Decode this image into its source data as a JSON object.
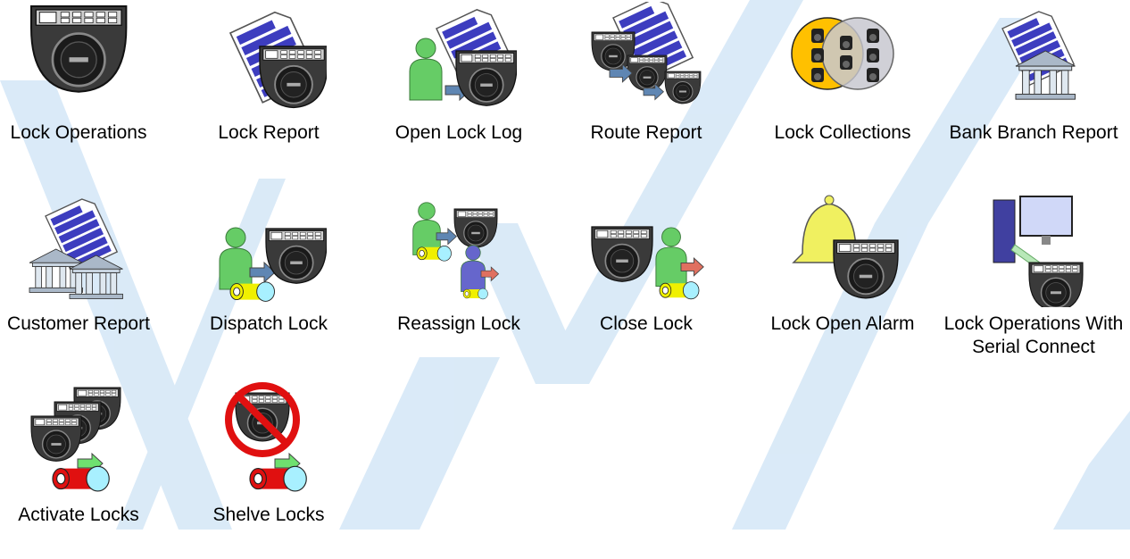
{
  "colors": {
    "watermark": "#cfe3f5",
    "lock_dark": "#3a3a3a",
    "lock_face": "#1a1a1a",
    "report_blue": "#3d3dbf",
    "person_green": "#66cc66",
    "person_purple": "#6666cc",
    "arrow_blue": "#5f86b3",
    "arrow_red": "#e07060",
    "arrow_green": "#6fe06f",
    "bell_yellow": "#f0f060",
    "collection_yellow": "#ffc000",
    "shelve_red": "#e01010"
  },
  "tiles": [
    {
      "label": "Lock Operations",
      "icon": "lock-keypad-icon"
    },
    {
      "label": "Lock Report",
      "icon": "lock-report-icon"
    },
    {
      "label": "Open Lock Log",
      "icon": "open-lock-log-icon"
    },
    {
      "label": "Route Report",
      "icon": "route-report-icon"
    },
    {
      "label": "Lock Collections",
      "icon": "lock-collections-icon"
    },
    {
      "label": "Bank Branch Report",
      "icon": "bank-branch-report-icon"
    },
    {
      "label": "Customer Report",
      "icon": "customer-report-icon"
    },
    {
      "label": "Dispatch Lock",
      "icon": "dispatch-lock-icon"
    },
    {
      "label": "Reassign Lock",
      "icon": "reassign-lock-icon"
    },
    {
      "label": "Close Lock",
      "icon": "close-lock-icon"
    },
    {
      "label": "Lock Open Alarm",
      "icon": "lock-open-alarm-icon"
    },
    {
      "label": "Lock Operations With\nSerial Connect",
      "icon": "serial-connect-icon"
    },
    {
      "label": "Activate Locks",
      "icon": "activate-locks-icon"
    },
    {
      "label": "Shelve Locks",
      "icon": "shelve-locks-icon"
    }
  ]
}
